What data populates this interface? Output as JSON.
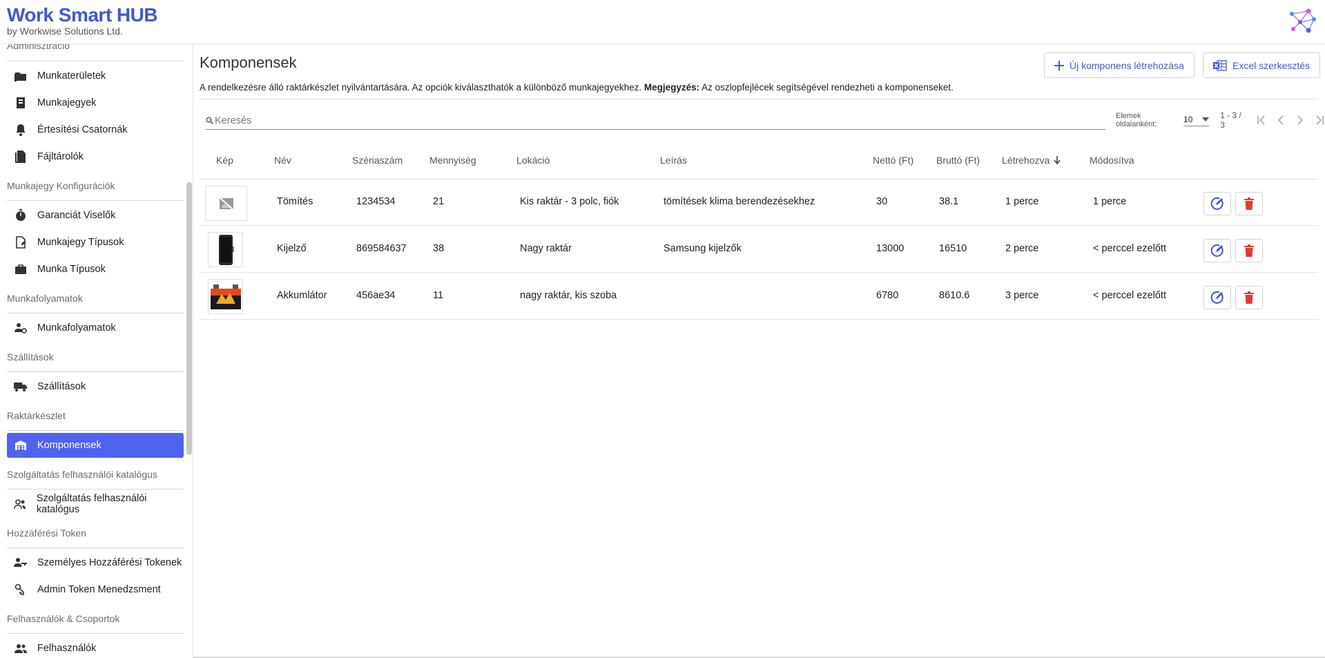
{
  "brand": {
    "title": "Work Smart HUB",
    "subtitle": "by Workwise Solutions Ltd."
  },
  "sidebar": {
    "sections": [
      {
        "label": "Adminisztráció"
      },
      {
        "label": "Munkajegy Konfigurációk"
      },
      {
        "label": "Munkafolyamatok"
      },
      {
        "label": "Szállítások"
      },
      {
        "label": "Raktárkészlet"
      },
      {
        "label": "Szolgáltatás felhasználói katalógus"
      },
      {
        "label": "Hozzáférési Token"
      },
      {
        "label": "Felhasználók & Csoportok"
      }
    ],
    "items": [
      {
        "label": "Munkaterületek",
        "icon": "folder-icon"
      },
      {
        "label": "Munkajegyek",
        "icon": "ticket-icon"
      },
      {
        "label": "Értesítési Csatornák",
        "icon": "bell-icon"
      },
      {
        "label": "Fájltárolók",
        "icon": "file-icon"
      },
      {
        "label": "Garanciát Viselők",
        "icon": "stopwatch-icon"
      },
      {
        "label": "Munkajegy Típusok",
        "icon": "document-edit-icon"
      },
      {
        "label": "Munka Típusok",
        "icon": "briefcase-icon"
      },
      {
        "label": "Munkafolyamatok",
        "icon": "user-gear-icon"
      },
      {
        "label": "Szállítások",
        "icon": "truck-icon"
      },
      {
        "label": "Komponensek",
        "icon": "warehouse-icon",
        "active": true
      },
      {
        "label": "Szolgáltatás felhasználói katalógus",
        "icon": "users-icon"
      },
      {
        "label": "Személyes Hozzáférési Tokenek",
        "icon": "user-key-icon"
      },
      {
        "label": "Admin Token Menedzsment",
        "icon": "key-gear-icon"
      },
      {
        "label": "Felhasználók",
        "icon": "users-icon"
      }
    ]
  },
  "page": {
    "title": "Komponensek",
    "desc_main": "A rendelkezésre álló raktárkészlet nyilvántartására. Az opciók kiválaszthatók a különböző munkajegyekhez.",
    "desc_note_label": "Megjegyzés:",
    "desc_note": "Az oszlopfejlécek segítségével rendezheti a komponenseket.",
    "new_button": "Új komponens létrehozása",
    "excel_button": "Excel szerkesztés"
  },
  "search": {
    "placeholder": "Keresés"
  },
  "pager": {
    "per_page_label": "Elemek oldalanként:",
    "per_page": "10",
    "range": "1 - 3 / 3"
  },
  "table": {
    "headers": {
      "image": "Kép",
      "name": "Név",
      "serial": "Szériaszám",
      "qty": "Mennyiség",
      "location": "Lokáció",
      "desc": "Leírás",
      "net": "Nettó (Ft)",
      "gross": "Bruttó (Ft)",
      "created": "Létrehozva",
      "modified": "Módosítva"
    },
    "rows": [
      {
        "image": "no-image-icon",
        "name": "Tömítés",
        "serial": "1234534",
        "qty": "21",
        "location": "Kis raktár - 3 polc, fiók",
        "desc": "tömítések klima berendezésekhez",
        "net": "30",
        "gross": "38.1",
        "created": "1 perce",
        "modified": "1 perce"
      },
      {
        "image": "phone-thumbnail",
        "name": "Kijelző",
        "serial": "869584637",
        "qty": "38",
        "location": "Nagy raktár",
        "desc": "Samsung kijelzők",
        "net": "13000",
        "gross": "16510",
        "created": "2 perce",
        "modified": "< perccel ezelőtt"
      },
      {
        "image": "battery-thumbnail",
        "name": "Akkumlátor",
        "serial": "456ae34",
        "qty": "11",
        "location": "nagy raktár, kis szoba",
        "desc": "",
        "net": "6780",
        "gross": "8610.6",
        "created": "3 perce",
        "modified": "< perccel ezelőtt"
      }
    ]
  },
  "colors": {
    "accent": "#4f63f0",
    "brand": "#4257d6",
    "danger": "#e53935"
  }
}
